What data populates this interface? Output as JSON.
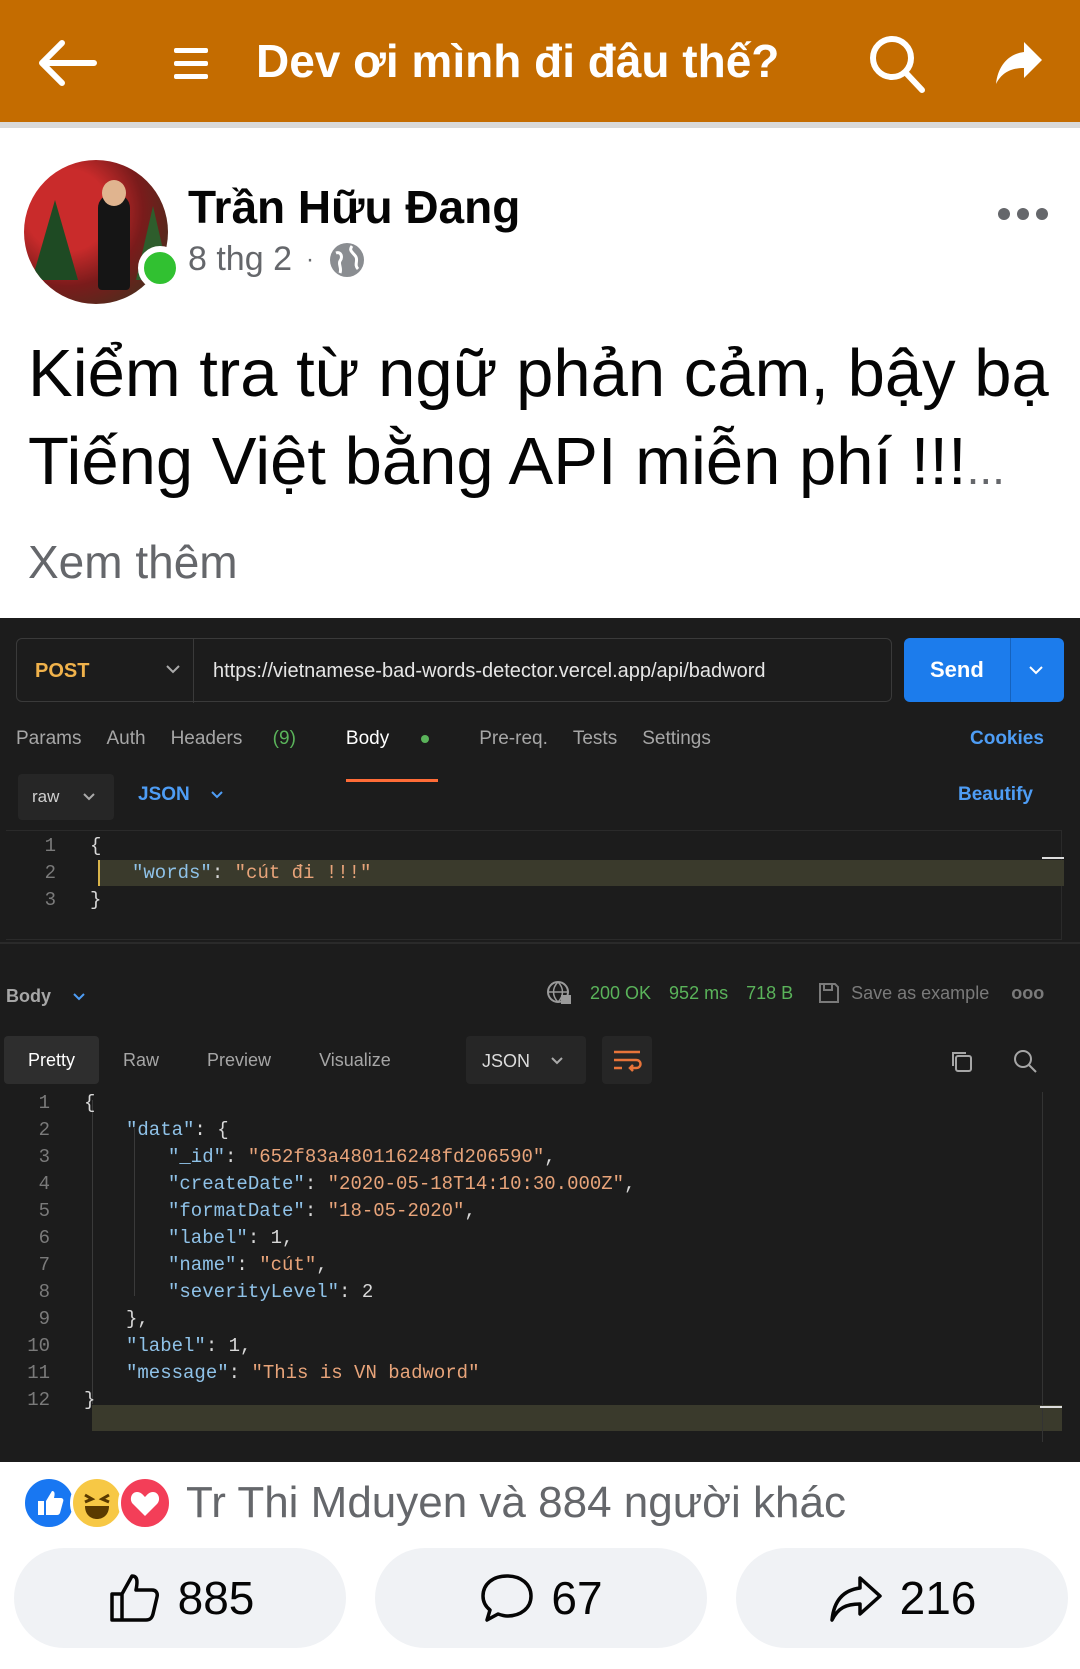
{
  "topbar": {
    "title": "Dev ơi mình đi đâu thế?",
    "icons": [
      "back-arrow-icon",
      "menu-icon",
      "search-icon",
      "share-icon"
    ],
    "background": "#c46c00"
  },
  "post": {
    "author": "Trần Hữu Đang",
    "date": "8 thg 2",
    "separator": "·",
    "text": "Kiểm tra từ ngữ phản cảm, bậy bạ Tiếng Việt bằng API miễn phí !!!",
    "see_more": "... Xem thêm"
  },
  "postman": {
    "method": "POST",
    "url": "https://vietnamese-bad-words-detector.vercel.app/api/badword",
    "send": "Send",
    "tabs": {
      "params": "Params",
      "auth": "Auth",
      "headers": "Headers",
      "headers_count": "(9)",
      "body": "Body",
      "prereq": "Pre-req.",
      "tests": "Tests",
      "settings": "Settings"
    },
    "cookies": "Cookies",
    "body_mode": "raw",
    "body_format": "JSON",
    "beautify": "Beautify",
    "request_lines": [
      {
        "n": "1",
        "t": "{"
      },
      {
        "n": "2",
        "key": "\"words\"",
        "sep": ": ",
        "val": "\"cút đi !!!\""
      },
      {
        "n": "3",
        "t": "}"
      }
    ],
    "response": {
      "label": "Body",
      "status": "200 OK",
      "time": "952 ms",
      "size": "718 B",
      "save": "Save as example",
      "more": "ooo",
      "tabs": [
        "Pretty",
        "Raw",
        "Preview",
        "Visualize"
      ],
      "format": "JSON",
      "lines": [
        {
          "n": "1",
          "indent": 0,
          "pre": "{"
        },
        {
          "n": "2",
          "indent": 1,
          "key": "\"data\"",
          "post": ": {"
        },
        {
          "n": "3",
          "indent": 2,
          "key": "\"_id\"",
          "post": ": ",
          "val": "\"652f83a480116248fd206590\"",
          "end": ","
        },
        {
          "n": "4",
          "indent": 2,
          "key": "\"createDate\"",
          "post": ": ",
          "val": "\"2020-05-18T14:10:30.000Z\"",
          "end": ","
        },
        {
          "n": "5",
          "indent": 2,
          "key": "\"formatDate\"",
          "post": ": ",
          "val": "\"18-05-2020\"",
          "end": ","
        },
        {
          "n": "6",
          "indent": 2,
          "key": "\"label\"",
          "post": ": 1,"
        },
        {
          "n": "7",
          "indent": 2,
          "key": "\"name\"",
          "post": ": ",
          "val": "\"cút\"",
          "end": ","
        },
        {
          "n": "8",
          "indent": 2,
          "key": "\"severityLevel\"",
          "post": ": 2"
        },
        {
          "n": "9",
          "indent": 1,
          "pre": "},"
        },
        {
          "n": "10",
          "indent": 1,
          "key": "\"label\"",
          "post": ": 1,"
        },
        {
          "n": "11",
          "indent": 1,
          "key": "\"message\"",
          "post": ": ",
          "val": "\"This is VN badword\""
        },
        {
          "n": "12",
          "indent": 0,
          "pre": "}"
        }
      ]
    }
  },
  "reactions": {
    "icons": [
      "like-icon",
      "haha-icon",
      "love-icon"
    ],
    "text": "Tr Thi Mduyen và 884 người khác"
  },
  "actions": {
    "like_count": "885",
    "comment_count": "67",
    "share_count": "216"
  }
}
